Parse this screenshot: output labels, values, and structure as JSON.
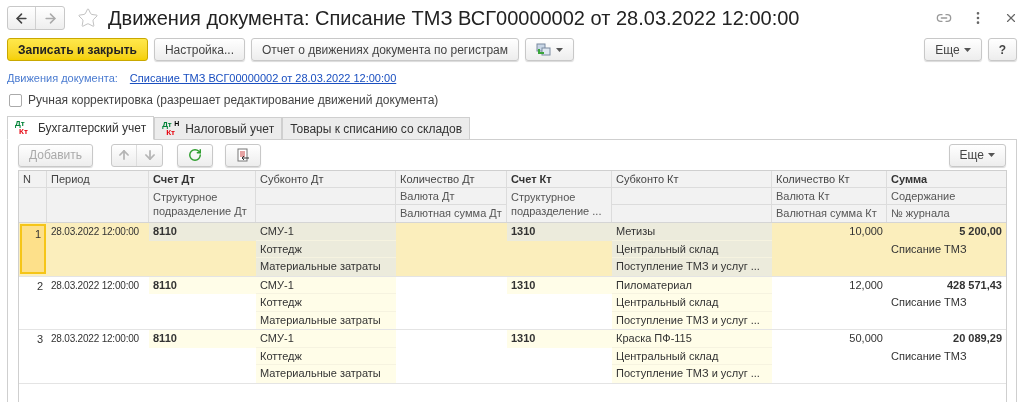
{
  "window": {
    "title": "Движения документа: Списание ТМЗ ВСГ00000002 от 28.03.2022 12:00:00"
  },
  "toolbar": {
    "primary": "Записать и закрыть",
    "buttons": [
      "Настройка...",
      "Отчет о движениях документа по регистрам"
    ],
    "more": "Еще",
    "help": "?"
  },
  "document": {
    "label": "Движения документа:",
    "link": "Списание ТМЗ ВСГ00000002 от 28.03.2022 12:00:00"
  },
  "manual_correction": {
    "label": "Ручная корректировка (разрешает редактирование движений документа)",
    "checked": false
  },
  "tabs": [
    {
      "label": "Бухгалтерский учет",
      "kind": "dtkt",
      "icon": {
        "debit": "Дт",
        "credit": "Кт"
      },
      "selected": true
    },
    {
      "label": "Налоговый учет",
      "kind": "dtktn",
      "icon": {
        "debit": "Дт",
        "credit": "Кт",
        "mark": "Н"
      },
      "selected": false
    },
    {
      "label": "Товары к списанию со складов",
      "kind": "plain",
      "selected": false
    }
  ],
  "table_toolbar": {
    "add": "Добавить",
    "more": "Еще"
  },
  "table": {
    "columns": [
      {
        "label": "N"
      },
      {
        "label": "Период"
      },
      {
        "label": "Счет Дт",
        "bold": true,
        "sublabels": [
          "Структурное подразделение Дт"
        ]
      },
      {
        "label": "Субконто Дт"
      },
      {
        "label": "Количество Дт",
        "sublabels": [
          "Валюта Дт",
          "Валютная сумма Дт"
        ]
      },
      {
        "label": "Счет Кт",
        "bold": true,
        "sublabels": [
          "Структурное подразделение ..."
        ]
      },
      {
        "label": "Субконто Кт"
      },
      {
        "label": "Количество Кт",
        "sublabels": [
          "Валюта Кт",
          "Валютная сумма Кт"
        ]
      },
      {
        "label": "Сумма",
        "bold": true,
        "sublabels": [
          "Содержание",
          "№ журнала"
        ]
      }
    ],
    "rows": [
      {
        "n": "1",
        "selected": true,
        "period": "28.03.2022 12:00:00",
        "account_dt": "8110",
        "subconto_dt": [
          "СМУ-1",
          "Коттедж",
          "Материальные затраты"
        ],
        "account_kt": "1310",
        "subconto_kt": [
          "Метизы",
          "Центральный склад",
          "Поступление ТМЗ и услуг ..."
        ],
        "quantity_kt": "10,000",
        "sum": "5 200,00",
        "content": "Списание ТМЗ"
      },
      {
        "n": "2",
        "selected": false,
        "period": "28.03.2022 12:00:00",
        "account_dt": "8110",
        "subconto_dt": [
          "СМУ-1",
          "Коттедж",
          "Материальные затраты"
        ],
        "account_kt": "1310",
        "subconto_kt": [
          "Пиломатериал",
          "Центральный склад",
          "Поступление ТМЗ и услуг ..."
        ],
        "quantity_kt": "12,000",
        "sum": "428 571,43",
        "content": "Списание ТМЗ"
      },
      {
        "n": "3",
        "selected": false,
        "period": "28.03.2022 12:00:00",
        "account_dt": "8110",
        "subconto_dt": [
          "СМУ-1",
          "Коттедж",
          "Материальные затраты"
        ],
        "account_kt": "1310",
        "subconto_kt": [
          "Краска ПФ-115",
          "Центральный склад",
          "Поступление ТМЗ и услуг ..."
        ],
        "quantity_kt": "50,000",
        "sum": "20 089,29",
        "content": "Списание ТМЗ"
      }
    ]
  }
}
